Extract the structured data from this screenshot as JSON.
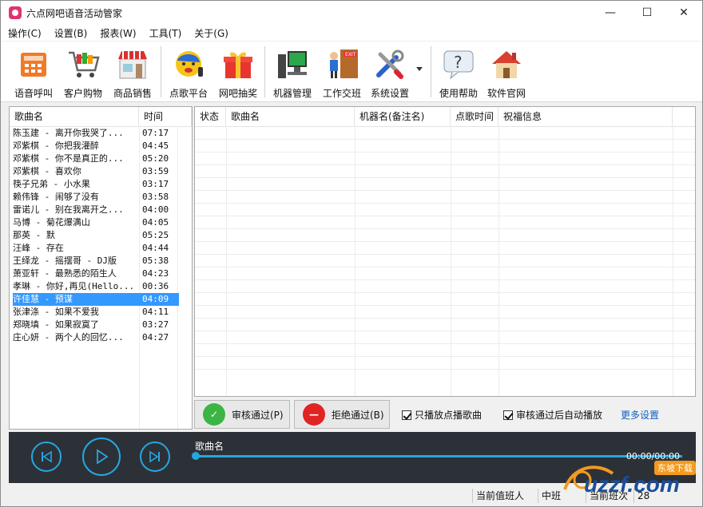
{
  "window": {
    "title": "六点网吧语音活动管家"
  },
  "menu": [
    "操作(C)",
    "设置(B)",
    "报表(W)",
    "工具(T)",
    "关于(G)"
  ],
  "toolbar": [
    "语音呼叫",
    "客户购物",
    "商品销售",
    "点歌平台",
    "网吧抽奖",
    "机器管理",
    "工作交班",
    "系统设置",
    "使用帮助",
    "软件官网"
  ],
  "songlist": {
    "headers": [
      "歌曲名",
      "时间"
    ],
    "rows": [
      {
        "title": "陈玉建 - 离开你我哭了...",
        "time": "07:17"
      },
      {
        "title": "邓紫棋 - 你把我灌醉",
        "time": "04:45"
      },
      {
        "title": "邓紫棋 - 你不是真正的...",
        "time": "05:20"
      },
      {
        "title": "邓紫棋 - 喜欢你",
        "time": "03:59"
      },
      {
        "title": "筷子兄弟 - 小水果",
        "time": "03:17"
      },
      {
        "title": "赖伟锋 - 闹够了没有",
        "time": "03:58"
      },
      {
        "title": "雷诺儿 - 别在我离开之...",
        "time": "04:00"
      },
      {
        "title": "马博 - 菊花爆满山",
        "time": "04:05"
      },
      {
        "title": "那英 - 默",
        "time": "05:25"
      },
      {
        "title": "汪峰 - 存在",
        "time": "04:44"
      },
      {
        "title": "王绎龙 - 摇摆哥 - DJ版",
        "time": "05:38"
      },
      {
        "title": "萧亚轩 - 最熟悉的陌生人",
        "time": "04:23"
      },
      {
        "title": "孝琳 - 你好,再见(Hello...",
        "time": "00:36"
      },
      {
        "title": "许佳慧 - 预谋",
        "time": "04:09",
        "selected": true
      },
      {
        "title": "张津涤 - 如果不爱我",
        "time": "04:11"
      },
      {
        "title": "郑晓填 - 如果寂寞了",
        "time": "03:27"
      },
      {
        "title": "庄心妍 - 两个人的回忆...",
        "time": "04:27"
      }
    ]
  },
  "requests": {
    "headers": [
      "状态",
      "歌曲名",
      "机器名(备注名)",
      "点歌时间",
      "祝福信息"
    ]
  },
  "actions": {
    "approve": "审核通过(P)",
    "reject": "拒绝通过(B)",
    "only_requested": "只播放点播歌曲",
    "auto_play": "审核通过后自动播放",
    "more": "更多设置"
  },
  "player": {
    "song_label": "歌曲名",
    "time": "00:00/00:00"
  },
  "status": {
    "duty_person": "当前值班人",
    "shift_mid": "中班",
    "current_shift": "当前班次",
    "count": "28"
  },
  "watermark": {
    "text": "uzzf.com",
    "sub": "东坡下载"
  },
  "colors": {
    "accent": "#25a7e0",
    "selection": "#3399ff",
    "approve": "#3cb544",
    "reject": "#e02424",
    "player_bg": "#2c3138"
  }
}
